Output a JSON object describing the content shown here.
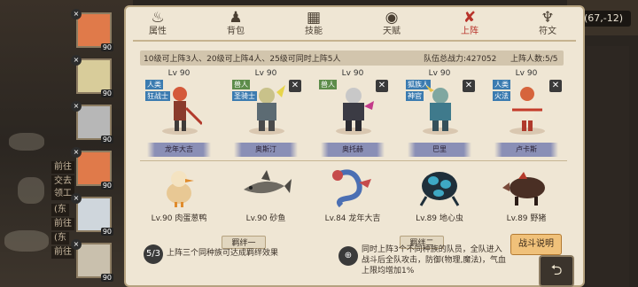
{
  "coords": "(67,-12)",
  "side_texts": [
    "前往",
    "交去",
    "领工",
    "(东",
    "前往",
    "(东",
    "前往"
  ],
  "tabs": [
    {
      "label": "属性",
      "icon": "flame-icon",
      "glyph": "♨"
    },
    {
      "label": "背包",
      "icon": "bag-icon",
      "glyph": "♟"
    },
    {
      "label": "技能",
      "icon": "book-icon",
      "glyph": "▦"
    },
    {
      "label": "天赋",
      "icon": "eye-icon",
      "glyph": "◉"
    },
    {
      "label": "上阵",
      "icon": "swords-icon",
      "glyph": "✘"
    },
    {
      "label": "符文",
      "icon": "rune-icon",
      "glyph": "♆"
    }
  ],
  "active_tab": 4,
  "info": {
    "rule": "10级可上阵3人、20级可上阵4人、25级可同时上阵5人",
    "power": "队伍总战力:427052",
    "count": "上阵人数:5/5"
  },
  "roster": [
    {
      "level": "90"
    },
    {
      "level": "90"
    },
    {
      "level": "90"
    },
    {
      "level": "90"
    },
    {
      "level": "90"
    },
    {
      "level": "90"
    }
  ],
  "lineup": [
    {
      "level": "Lv 90",
      "tags": [
        "人类",
        "狂战士"
      ],
      "name": "龙年大吉"
    },
    {
      "level": "Lv 90",
      "tags": [
        "兽人",
        "圣骑士"
      ],
      "name": "奥斯汀"
    },
    {
      "level": "Lv 90",
      "tags": [
        "兽人"
      ],
      "name": "奥托赫"
    },
    {
      "level": "Lv 90",
      "tags": [
        "狐族人",
        "神官"
      ],
      "name": "巴里"
    },
    {
      "level": "Lv 90",
      "tags": [
        "人类",
        "火法"
      ],
      "name": "卢卡斯"
    }
  ],
  "beasts": [
    {
      "name": "Lv.90 肉蛋葱鸭"
    },
    {
      "name": "Lv.90 砂鱼"
    },
    {
      "name": "Lv.84 龙年大吉"
    },
    {
      "name": "Lv.89 地心虫"
    },
    {
      "name": "Lv.89 野猪"
    }
  ],
  "bond1": {
    "title": "羁绊一",
    "text": "上阵三个同种族可达成羁绊效果",
    "badge": "5/3"
  },
  "bond2": {
    "title": "羁绊二",
    "lines": [
      "同时上阵3个不同种族的队员，全队进入",
      "战斗后全队攻击，防御(物理,魔法)，气血",
      "上限均增加1%"
    ]
  },
  "battle_button": "战斗说明",
  "colors": {
    "active": "#b8322a",
    "panel": "#efe6d4",
    "ribbon": "#8a8fb6"
  }
}
